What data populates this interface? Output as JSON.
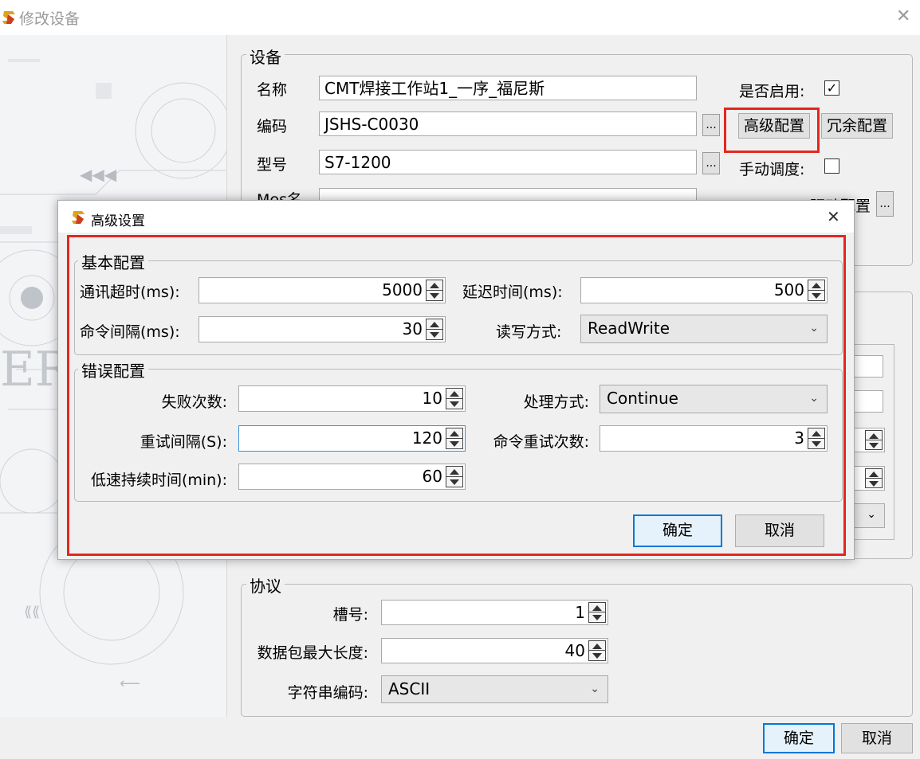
{
  "window": {
    "title": "修改设备",
    "close": "✕"
  },
  "device": {
    "group_label": "设备",
    "name_label": "名称",
    "name_value": "CMT焊接工作站1_一序_福尼斯",
    "code_label": "编码",
    "code_value": "JSHS-C0030",
    "model_label": "型号",
    "model_value": "S7-1200",
    "mes_label": "Mes名",
    "enabled_label": "是否启用:",
    "enabled_checked": true,
    "advanced_button": "高级配置",
    "redundant_button": "冗余配置",
    "manual_label": "手动调度:",
    "manual_checked": false,
    "driver_label": "驱动配置",
    "ellipsis": "..."
  },
  "protocol": {
    "group_label": "协议",
    "slot_label": "槽号:",
    "slot_value": "1",
    "maxpkt_label": "数据包最大长度:",
    "maxpkt_value": "40",
    "encoding_label": "字符串编码:",
    "encoding_value": "ASCII"
  },
  "footer": {
    "ok": "确定",
    "cancel": "取消"
  },
  "dialog": {
    "title": "高级设置",
    "close": "✕",
    "basic": {
      "label": "基本配置",
      "timeout_label": "通讯超时(ms):",
      "timeout_value": "5000",
      "delay_label": "延迟时间(ms):",
      "delay_value": "500",
      "interval_label": "命令间隔(ms):",
      "interval_value": "30",
      "rw_label": "读写方式:",
      "rw_value": "ReadWrite"
    },
    "error": {
      "label": "错误配置",
      "fail_label": "失败次数:",
      "fail_value": "10",
      "handle_label": "处理方式:",
      "handle_value": "Continue",
      "retry_interval_label": "重试间隔(S):",
      "retry_interval_value": "120",
      "retry_count_label": "命令重试次数:",
      "retry_count_value": "3",
      "lowspeed_label": "低速持续时间(min):",
      "lowspeed_value": "60"
    },
    "ok": "确定",
    "cancel": "取消"
  },
  "colors": {
    "highlight": "#e5261d",
    "focus_blue": "#0078d7"
  }
}
